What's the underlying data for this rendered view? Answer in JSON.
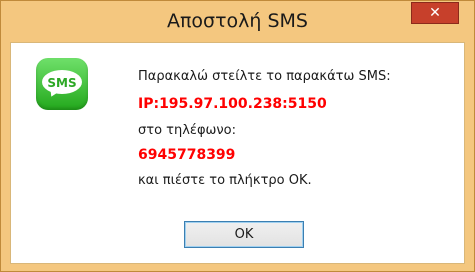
{
  "window": {
    "title": "Αποστολή SMS",
    "close_label": "✕"
  },
  "icon": {
    "name": "sms-icon",
    "label": "SMS"
  },
  "message": {
    "line1": "Παρακαλώ στείλτε το παρακάτω SMS:",
    "sms_text": "IP:195.97.100.238:5150",
    "line3": "στο τηλέφωνο:",
    "phone": "6945778399",
    "line5": "και πιέστε το πλήκτρο OK."
  },
  "buttons": {
    "ok_label": "OK"
  },
  "colors": {
    "titlebar": "#f4c77f",
    "close_button": "#c7402b",
    "highlight_text": "#ff0000",
    "icon_green": "#2ca825"
  }
}
